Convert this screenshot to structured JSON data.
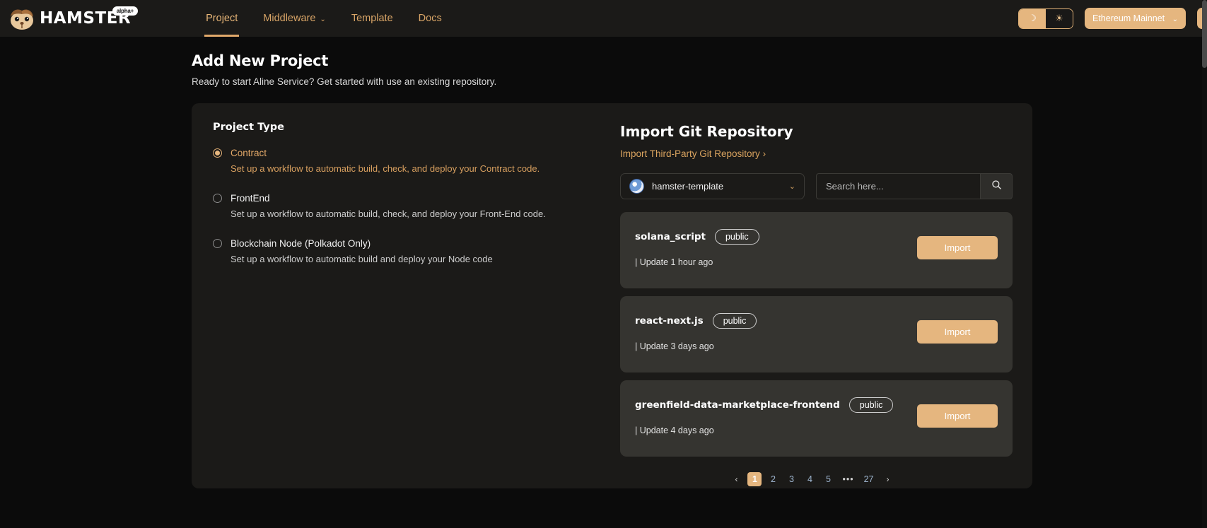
{
  "brand": {
    "logo_text": "HAMSTER",
    "alpha_badge": "alpha+",
    "logo_icon": "hamster-face-icon"
  },
  "nav": {
    "items": [
      {
        "label": "Project",
        "active": true,
        "has_caret": false
      },
      {
        "label": "Middleware",
        "active": false,
        "has_caret": true
      },
      {
        "label": "Template",
        "active": false,
        "has_caret": false
      },
      {
        "label": "Docs",
        "active": false,
        "has_caret": false
      }
    ]
  },
  "topright": {
    "theme": {
      "dark_icon": "moon-icon",
      "light_icon": "sun-icon",
      "dark_glyph": "☽",
      "light_glyph": "☀",
      "active": "light"
    },
    "network": {
      "value": "Ethereum Mainnet",
      "caret": "∨"
    }
  },
  "page": {
    "title": "Add New Project",
    "subtitle": "Ready to start Aline Service? Get started with use an existing repository."
  },
  "project_type": {
    "title": "Project Type",
    "options": [
      {
        "label": "Contract",
        "description": "Set up a workflow to automatic build, check, and deploy your Contract code.",
        "selected": true
      },
      {
        "label": "FrontEnd",
        "description": "Set up a workflow to automatic build, check, and deploy your Front-End code.",
        "selected": false
      },
      {
        "label": "Blockchain Node (Polkadot Only)",
        "description": "Set up a workflow to automatic build and deploy your Node code",
        "selected": false
      }
    ]
  },
  "import": {
    "title": "Import Git Repository",
    "third_party_link": "Import Third-Party Git Repository",
    "third_party_chevron": "›",
    "org": {
      "name": "hamster-template",
      "avatar_icon": "org-avatar-icon",
      "caret": "∨"
    },
    "search": {
      "placeholder": "Search here...",
      "value": "",
      "button_icon": "search-icon"
    },
    "repos": [
      {
        "name": "solana_script",
        "visibility": "public",
        "updated": "| Update 1 hour ago",
        "action_label": "Import"
      },
      {
        "name": "react-next.js",
        "visibility": "public",
        "updated": "| Update 3 days ago",
        "action_label": "Import"
      },
      {
        "name": "greenfield-data-marketplace-frontend",
        "visibility": "public",
        "updated": "| Update 4 days ago",
        "action_label": "Import"
      }
    ],
    "pagination": {
      "prev": "‹",
      "next": "›",
      "pages": [
        "1",
        "2",
        "3",
        "4",
        "5",
        "•••",
        "27"
      ],
      "current": "1"
    }
  },
  "colors": {
    "accent": "#e5b67f",
    "accent_text": "#d9a567",
    "page_bg": "#0b0b0b",
    "panel_bg": "#1b1a18",
    "card_bg": "#353430"
  }
}
